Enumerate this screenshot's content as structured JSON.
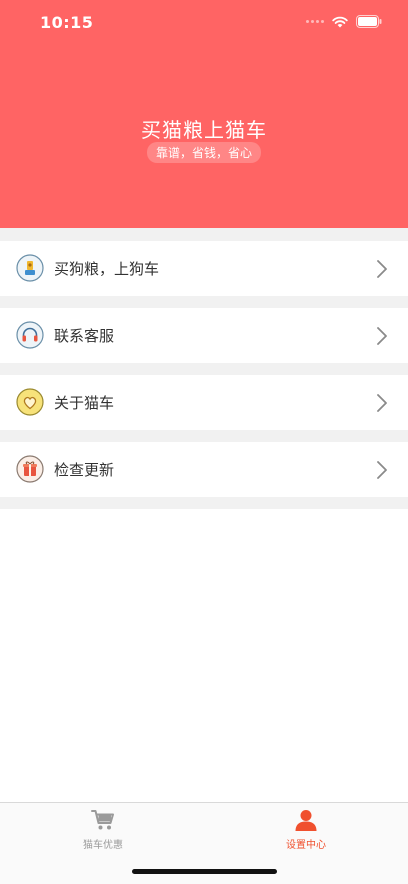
{
  "status_bar": {
    "time": "10:15"
  },
  "header": {
    "title": "买猫粮上猫车",
    "subtitle": "靠谱，省钱，省心",
    "bg_color": "#ff6464"
  },
  "menu": {
    "items": [
      {
        "label": "买狗粮，上狗车",
        "icon": "dog-food-icon"
      },
      {
        "label": "联系客服",
        "icon": "headphones-icon"
      },
      {
        "label": "关于猫车",
        "icon": "heart-icon"
      },
      {
        "label": "检查更新",
        "icon": "gift-box-icon"
      }
    ]
  },
  "tabbar": {
    "tabs": [
      {
        "label": "猫车优惠",
        "icon": "cart-icon",
        "active": false
      },
      {
        "label": "设置中心",
        "icon": "user-icon",
        "active": true
      }
    ],
    "active_color": "#f0502e",
    "inactive_color": "#9a9a9a"
  }
}
